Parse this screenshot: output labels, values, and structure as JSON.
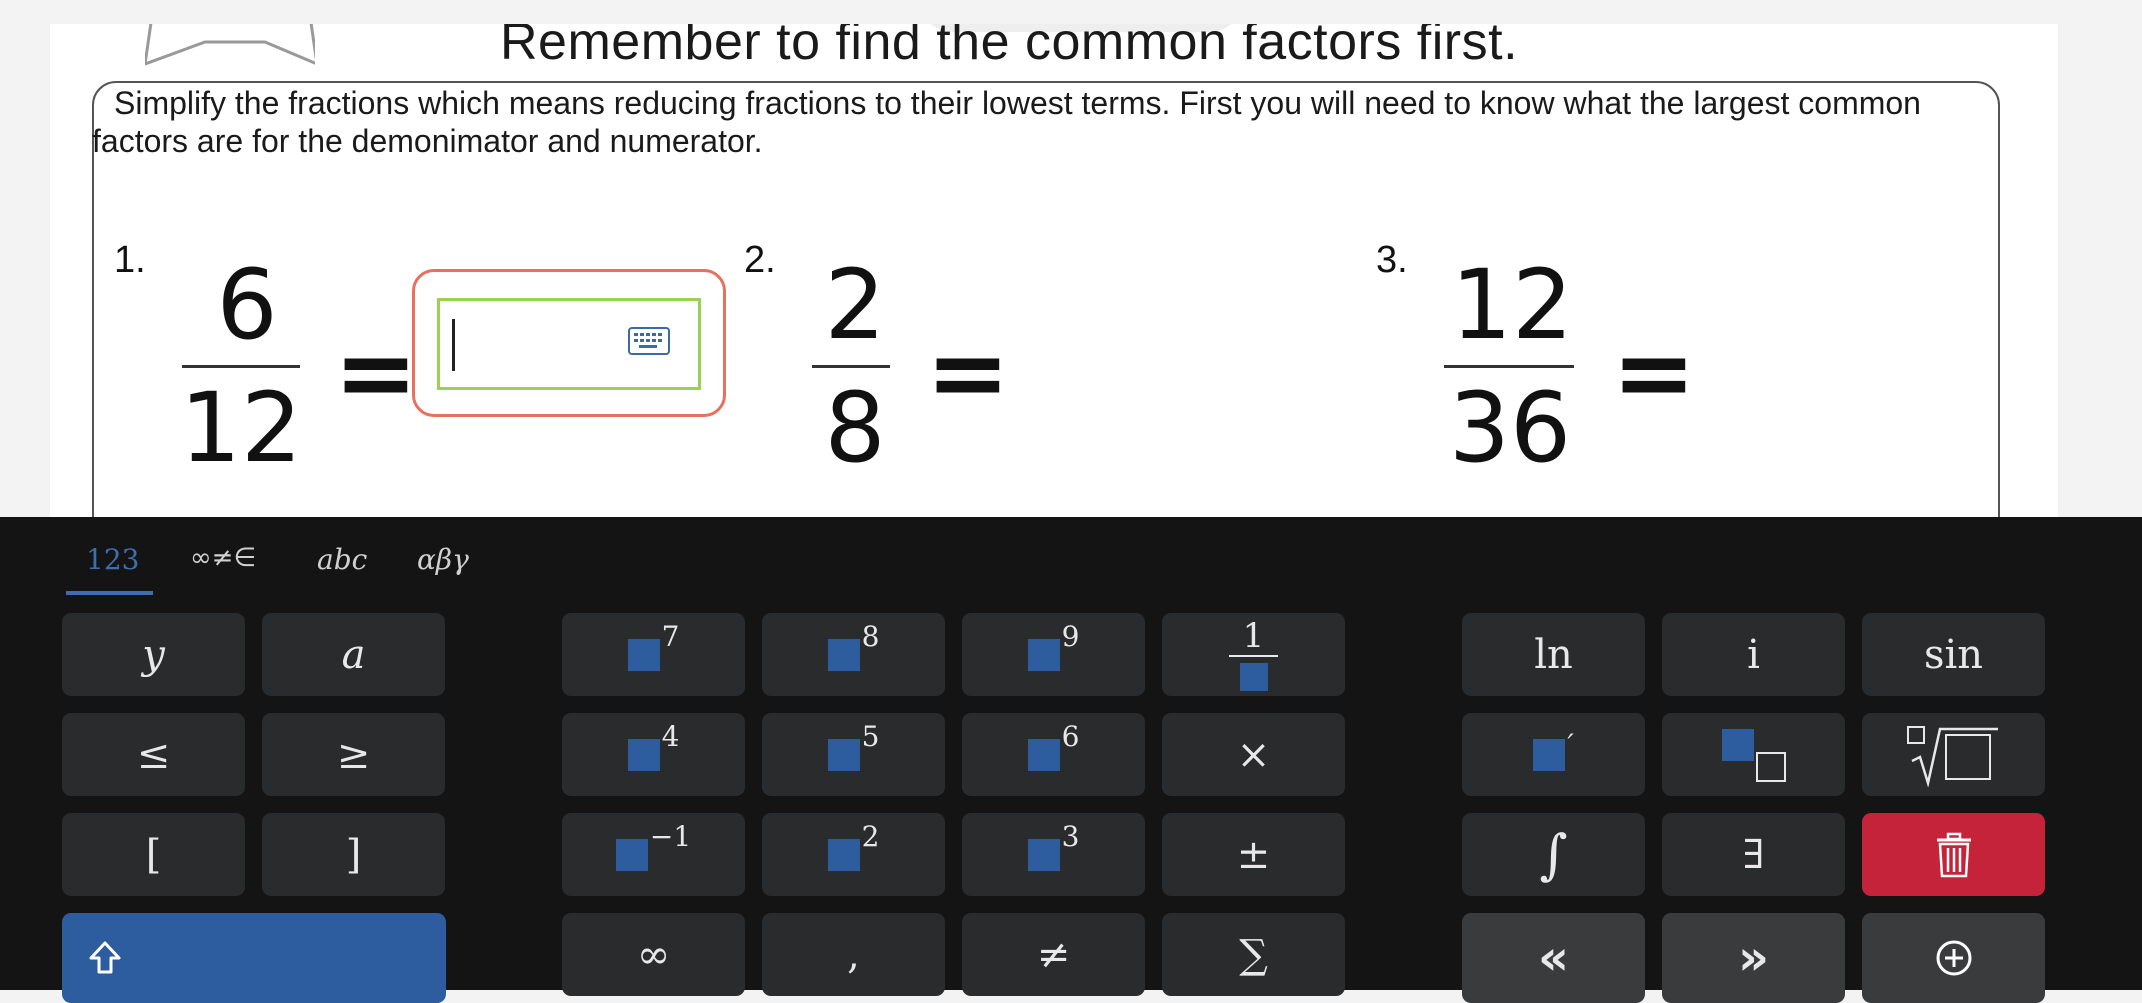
{
  "worksheet": {
    "heading": "Remember to find the common factors first.",
    "instructions": "Simplify the fractions which means reducing fractions to their lowest terms. First you will need to know what the largest common factors are for the demonimator and numerator.",
    "problems": [
      {
        "number": "1.",
        "numerator": "6",
        "denominator": "12",
        "equals": "="
      },
      {
        "number": "2.",
        "numerator": "2",
        "denominator": "8",
        "equals": "="
      },
      {
        "number": "3.",
        "numerator": "12",
        "denominator": "36",
        "equals": "="
      }
    ],
    "answer_value": ""
  },
  "keyboard": {
    "tabs": [
      "123",
      "∞≠∈",
      "abc",
      "αβγ"
    ],
    "active_tab": "123",
    "keys": {
      "y": "y",
      "a": "a",
      "le": "≤",
      "ge": "≥",
      "lbracket": "[",
      "rbracket": "]",
      "p7": "7",
      "p8": "8",
      "p9": "9",
      "p4": "4",
      "p5": "5",
      "p6": "6",
      "pinv": "−1",
      "p2": "2",
      "p3": "3",
      "frac_top": "1",
      "times": "×",
      "plusminus": "±",
      "infinity": "∞",
      "comma": ",",
      "neq": "≠",
      "sum": "∑",
      "ln": "ln",
      "i": "i",
      "sin": "sin",
      "prime": "′",
      "integral": "∫",
      "exists": "∃",
      "left": "«",
      "right": "»"
    },
    "colors": {
      "accent": "#2d5d9e",
      "delete": "#c4233a",
      "key": "#2a2b2d",
      "background": "#141414"
    }
  }
}
